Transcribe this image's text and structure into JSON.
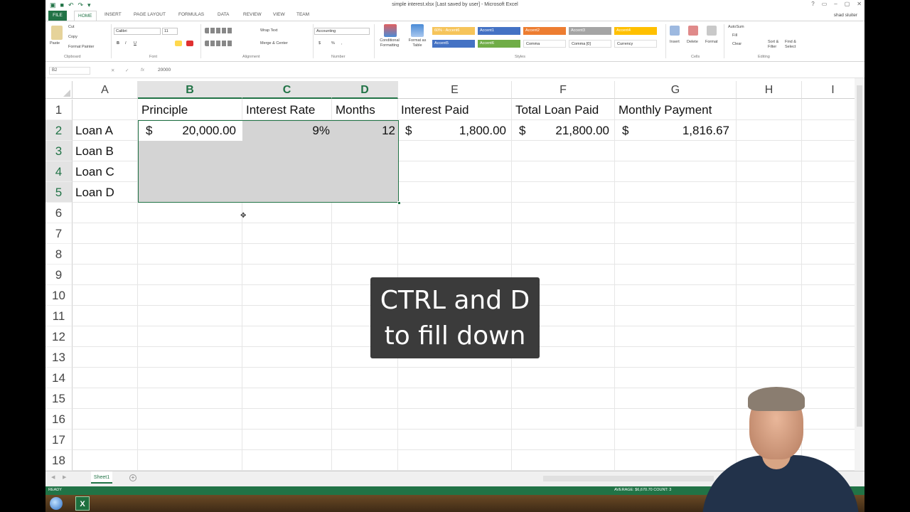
{
  "window": {
    "title": "simple interest.xlsx [Last saved by user] - Microsoft Excel",
    "user": "shad sluiter",
    "controls": [
      "?",
      "▭",
      "–",
      "▢",
      "✕"
    ]
  },
  "ribbon_tabs": [
    "FILE",
    "HOME",
    "INSERT",
    "PAGE LAYOUT",
    "FORMULAS",
    "DATA",
    "REVIEW",
    "VIEW",
    "TEAM"
  ],
  "ribbon": {
    "clipboard": {
      "paste": "Paste",
      "cut": "Cut",
      "copy": "Copy",
      "format_painter": "Format Painter",
      "label": "Clipboard"
    },
    "font": {
      "name": "Calibri",
      "size": "11",
      "bold": "B",
      "italic": "I",
      "underline": "U",
      "label": "Font"
    },
    "alignment": {
      "wrap": "Wrap Text",
      "merge": "Merge & Center",
      "label": "Alignment"
    },
    "number": {
      "format": "Accounting",
      "currency": "$",
      "percent": "%",
      "comma": ",",
      "label": "Number"
    },
    "styles": {
      "conditional": "Conditional Formatting",
      "format_table": "Format as Table",
      "cells": [
        {
          "name": "60% - Accent6",
          "color": "#f6c45a"
        },
        {
          "name": "Accent1",
          "color": "#4472c4"
        },
        {
          "name": "Accent2",
          "color": "#ed7d31"
        },
        {
          "name": "Accent3",
          "color": "#a5a5a5"
        },
        {
          "name": "Accent4",
          "color": "#ffc000"
        },
        {
          "name": "Accent5",
          "color": "#4472c4"
        },
        {
          "name": "Accent6",
          "color": "#70ad47"
        },
        {
          "name": "Comma",
          "color": "#ffffff"
        },
        {
          "name": "Comma [0]",
          "color": "#ffffff"
        },
        {
          "name": "Currency",
          "color": "#ffffff"
        }
      ],
      "label": "Styles"
    },
    "cells": {
      "insert": "Insert",
      "delete": "Delete",
      "format": "Format",
      "label": "Cells"
    },
    "editing": {
      "autosum": "AutoSum",
      "fill": "Fill",
      "clear": "Clear",
      "sort": "Sort & Filter",
      "find": "Find & Select",
      "label": "Editing"
    }
  },
  "formula_bar": {
    "name_box": "B2",
    "fx": "fx",
    "value": "20000"
  },
  "columns": [
    "A",
    "B",
    "C",
    "D",
    "E",
    "F",
    "G",
    "H",
    "I"
  ],
  "rows": [
    "1",
    "2",
    "3",
    "4",
    "5",
    "6",
    "7",
    "8",
    "9",
    "10",
    "11",
    "12",
    "13",
    "14",
    "15",
    "16",
    "17",
    "18"
  ],
  "cells": {
    "B1": "Principle",
    "C1": "Interest Rate",
    "D1": "Months",
    "E1": "Interest Paid",
    "F1": "Total Loan Paid",
    "G1": "Monthly Payment",
    "A2": "Loan A",
    "B2_sym": "$",
    "B2": "20,000.00",
    "C2": "9%",
    "D2": "12",
    "E2_sym": "$",
    "E2": "1,800.00",
    "F2_sym": "$",
    "F2": "21,800.00",
    "G2_sym": "$",
    "G2": "1,816.67",
    "A3": "Loan B",
    "A4": "Loan C",
    "A5": "Loan D"
  },
  "sheet_tab": "Sheet1",
  "status": {
    "ready": "READY",
    "summary": "AVERAGE: $6,670.70    COUNT: 3"
  },
  "caption": {
    "line1": "CTRL and D",
    "line2": "to fill down"
  }
}
